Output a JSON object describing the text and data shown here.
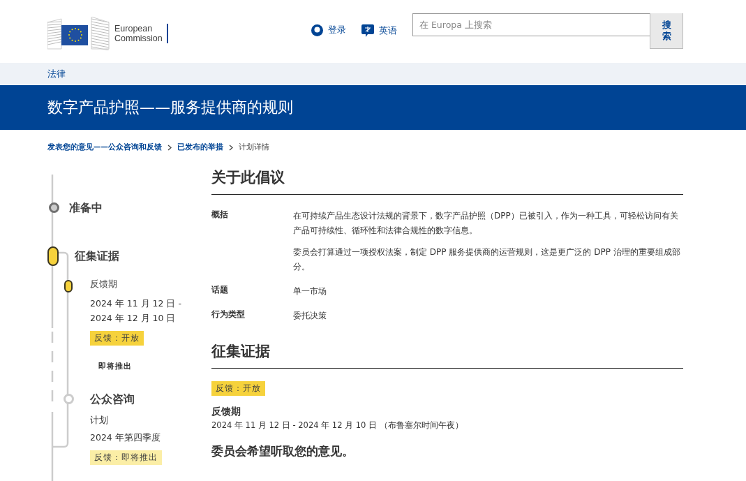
{
  "header": {
    "logo_text": [
      "European",
      "Commission"
    ],
    "login": "登录",
    "language": "英语",
    "search": {
      "placeholder": "在 Europa 上搜索",
      "button": "搜索"
    }
  },
  "nav": {
    "label": "法律"
  },
  "title": "数字产品护照——服务提供商的规则",
  "breadcrumb": [
    {
      "label": "发表您的意见——公众咨询和反馈",
      "link": true
    },
    {
      "label": "已发布的举措",
      "link": true
    },
    {
      "label": "计划详情",
      "link": false
    }
  ],
  "timeline": [
    {
      "kind": "phase",
      "title": "准备中",
      "completed": true,
      "current": false
    },
    {
      "kind": "phase",
      "title": "征集证据",
      "current": true,
      "children": [
        {
          "kind": "period",
          "title": "反馈期",
          "current": true,
          "lines": [
            "2024 年 11 月 12 日 - 2024 年 12 月 10 日"
          ],
          "badge": {
            "text": "反馈：开放",
            "open": true
          }
        },
        {
          "kind": "note",
          "title": "即将推出"
        },
        {
          "kind": "phase",
          "title": "公众咨询",
          "completed": false,
          "current": false,
          "lines": [
            "计划",
            "2024 年第四季度"
          ],
          "badge": {
            "text": "反馈：即将推出",
            "open": false
          }
        }
      ]
    }
  ],
  "about": {
    "heading": "关于此倡议",
    "rows": [
      {
        "label": "概括",
        "paragraphs": [
          "在可持续产品生态设计法规的背景下，数字产品护照（DPP）已被引入，作为一种工具，可轻松访问有关产品可持续性、循环性和法律合规性的数字信息。",
          "委员会打算通过一项授权法案，制定 DPP 服务提供商的运营规则，这是更广泛的 DPP 治理的重要组成部分。"
        ]
      },
      {
        "label": "话题",
        "paragraphs": [
          "单一市场"
        ]
      },
      {
        "label": "行为类型",
        "paragraphs": [
          "委托决策"
        ]
      }
    ]
  },
  "evidence": {
    "heading": "征集证据",
    "badge": {
      "text": "反馈：开放",
      "open": true
    },
    "period_label": "反馈期",
    "period": "2024 年 11 月 12 日 - 2024 年 12 月 10 日 （布鲁塞尔时间午夜）",
    "subheading": "委员会希望听取您的意见。"
  }
}
